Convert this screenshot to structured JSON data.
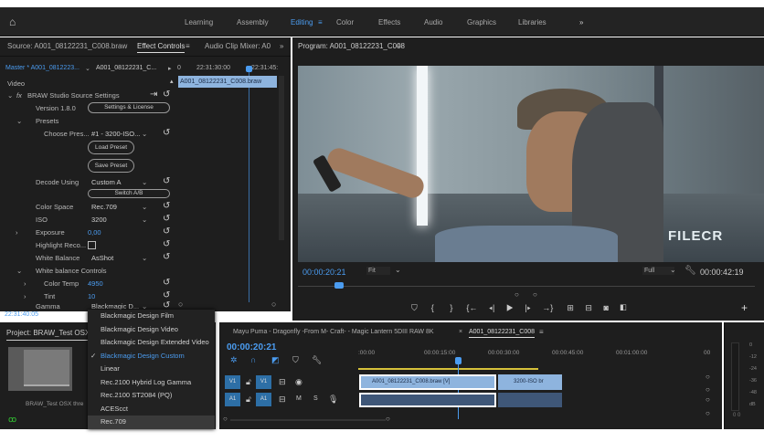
{
  "topbar": {
    "workspaces": [
      "Learning",
      "Assembly",
      "Editing",
      "Color",
      "Effects",
      "Audio",
      "Graphics",
      "Libraries"
    ],
    "active": "Editing",
    "more": "»"
  },
  "source_panel": {
    "tabs": {
      "source": "Source: A001_08122231_C008.braw",
      "effect_controls": "Effect Controls",
      "audio_mixer": "Audio Clip Mixer: A0",
      "more": "»"
    },
    "master": "Master * A001_0812223...",
    "clip": "A001_08122231_C...",
    "ruler": [
      "0",
      "22:31:30:00",
      "22:31:45:"
    ],
    "clip_bar": "A001_08122231_C008.braw",
    "section": "Video",
    "effect": "BRAW Studio Source Settings",
    "fx": "fx",
    "rows": [
      {
        "label": "Version 1.8.0",
        "button": "Settings & License"
      },
      {
        "label": "Presets"
      },
      {
        "label": "Choose Pres...",
        "value": "#1 - 3200-ISO..."
      },
      {
        "button": "Load Preset"
      },
      {
        "button": "Save Preset"
      },
      {
        "label": "Decode Using",
        "value": "Custom A"
      },
      {
        "button": "Switch A/B"
      },
      {
        "label": "Color Space",
        "value": "Rec.709"
      },
      {
        "label": "ISO",
        "value": "3200"
      },
      {
        "label": "Exposure",
        "value": "0,00"
      },
      {
        "label": "Highlight Reco..."
      },
      {
        "label": "White Balance",
        "value": "AsShot"
      },
      {
        "label": "White balance Controls"
      },
      {
        "label": "Color Temp",
        "value": "4950"
      },
      {
        "label": "Tint",
        "value": "10"
      },
      {
        "label": "Gamma",
        "value": "Blackmagic D..."
      }
    ],
    "timecode": "22:31:40:05"
  },
  "program": {
    "title": "Program: A001_08122231_C008",
    "timecode": "00:00:20:21",
    "fit": "Fit",
    "quality": "Full",
    "duration": "00:00:42:19",
    "watermark": "FILECR",
    "playhead_fraction": 0.08
  },
  "gamma_menu": {
    "items": [
      "Blackmagic Design Film",
      "Blackmagic Design Video",
      "Blackmagic Design Extended Video",
      "Blackmagic Design Custom",
      "Linear",
      "Rec.2100 Hybrid Log Gamma",
      "Rec.2100 ST2084 (PQ)",
      "ACEScct",
      "Rec.709"
    ],
    "selected": "Blackmagic Design Custom",
    "highlighted": "Rec.709"
  },
  "project": {
    "title": "Project: BRAW_Test OSX th",
    "item": "BRAW_Test OSX thre"
  },
  "timeline": {
    "tabs": [
      "Mayu Puma - Dragonfly -From M- Craft- - Magic Lantern 5DIII RAW 8K",
      "A001_08122231_C008"
    ],
    "timecode": "00:00:20:21",
    "ruler": [
      ":00:00",
      "00:00:15:00",
      "00:00:30:00",
      "00:00:45:00",
      "00:01:00:00",
      "00"
    ],
    "tracks": [
      "V1",
      "A1"
    ],
    "clips": [
      "A001_08122231_C008.braw [V]",
      "3200-ISO br"
    ],
    "track_m": "M",
    "track_s": "S"
  },
  "meter": {
    "ticks": [
      "0",
      "-12",
      "-24",
      "-36",
      "-48",
      "dB"
    ],
    "footer": "0 0"
  }
}
